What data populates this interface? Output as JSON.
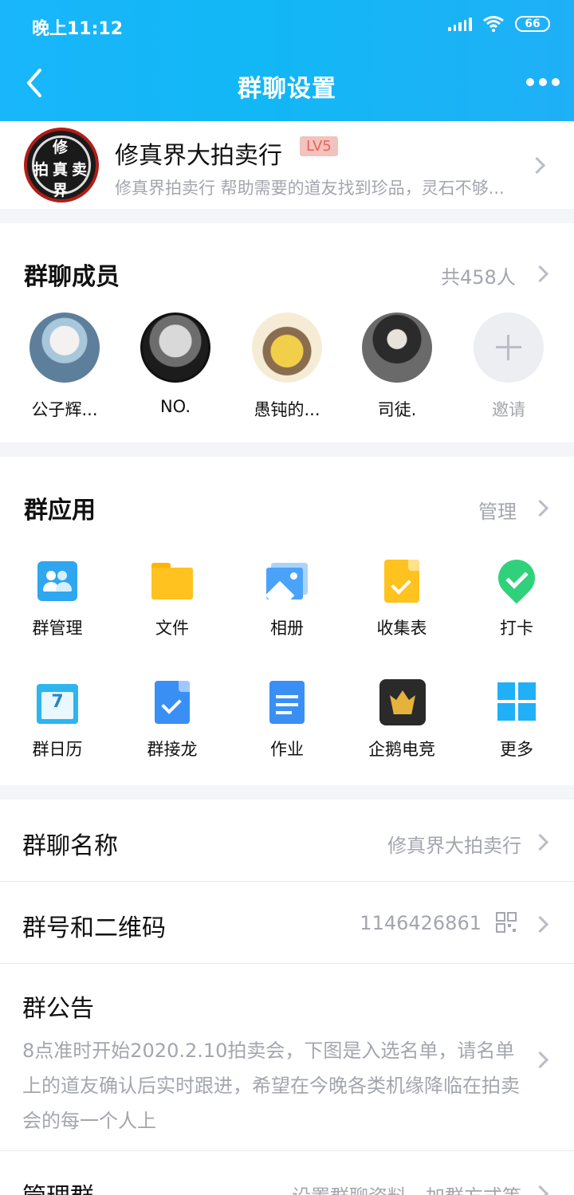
{
  "status_bar": {
    "time": "晚上11:12",
    "battery": "66"
  },
  "nav": {
    "title": "群聊设置"
  },
  "group": {
    "avatar_chars": [
      "修",
      "拍",
      "真",
      "卖",
      "界"
    ],
    "name": "修真界大拍卖行",
    "level": "LV5",
    "description": "修真界拍卖行 帮助需要的道友找到珍品，灵石不够..."
  },
  "members": {
    "title": "群聊成员",
    "count_label": "共458人",
    "list": [
      {
        "name": "公子辉..."
      },
      {
        "name": "NO."
      },
      {
        "name": "愚钝的..."
      },
      {
        "name": "司徒."
      }
    ],
    "invite_label": "邀请"
  },
  "apps": {
    "title": "群应用",
    "manage_label": "管理",
    "items": [
      {
        "label": "群管理",
        "icon": "group-manage-icon",
        "color": "#2fa7f0"
      },
      {
        "label": "文件",
        "icon": "folder-icon",
        "color": "#ffc21f"
      },
      {
        "label": "相册",
        "icon": "photo-album-icon",
        "color": "#4aa3f8"
      },
      {
        "label": "收集表",
        "icon": "collect-form-icon",
        "color": "#ffc21f"
      },
      {
        "label": "打卡",
        "icon": "check-in-icon",
        "color": "#2fd27a"
      },
      {
        "label": "群日历",
        "icon": "calendar-icon",
        "color": "#2db5ee"
      },
      {
        "label": "群接龙",
        "icon": "relay-icon",
        "color": "#3a8ff5"
      },
      {
        "label": "作业",
        "icon": "homework-icon",
        "color": "#3a8ff5"
      },
      {
        "label": "企鹅电竞",
        "icon": "penguin-esports-icon",
        "color": "#e5b33a"
      },
      {
        "label": "更多",
        "icon": "more-apps-icon",
        "color": "#1fb0f7"
      }
    ]
  },
  "settings": {
    "name_row": {
      "label": "群聊名称",
      "value": "修真界大拍卖行"
    },
    "number_row": {
      "label": "群号和二维码",
      "value": "1146426861"
    },
    "notice_row": {
      "label": "群公告",
      "text": "8点准时开始2020.2.10拍卖会，下图是入选名单，请名单上的道友确认后实时跟进，希望在今晚各类机缘降临在拍卖会的每一个人上"
    },
    "manage_row": {
      "label": "管理群",
      "value": "设置群聊资料、加群方式等"
    }
  }
}
